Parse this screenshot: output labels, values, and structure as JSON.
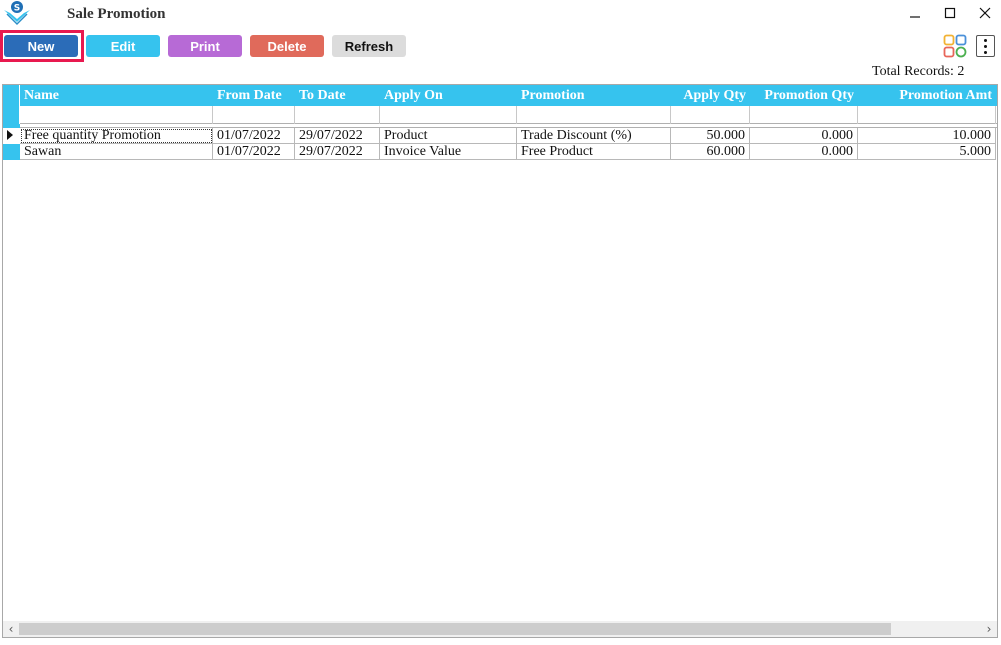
{
  "window": {
    "title": "Sale Promotion"
  },
  "toolbar": {
    "new_label": "New",
    "edit_label": "Edit",
    "print_label": "Print",
    "delete_label": "Delete",
    "refresh_label": "Refresh"
  },
  "icons": {
    "app": "app-logo-icon",
    "layout": "layout-grid-icon",
    "more": "more-vertical-icon"
  },
  "total_records": "Total Records: 2",
  "table": {
    "columns": [
      "Name",
      "From Date",
      "To Date",
      "Apply On",
      "Promotion",
      "Apply Qty",
      "Promotion Qty",
      "Promotion Amt"
    ],
    "rows": [
      [
        "Free quantity Promotion",
        "01/07/2022",
        "29/07/2022",
        "Product",
        "Trade Discount (%)",
        "50.000",
        "0.000",
        "10.000"
      ],
      [
        "Sawan",
        "01/07/2022",
        "29/07/2022",
        "Invoice Value",
        "Free Product",
        "60.000",
        "0.000",
        "5.000"
      ]
    ]
  },
  "colors": {
    "header": "#36c3ee",
    "new": "#2b6cb8",
    "edit": "#36c3ee",
    "print": "#b76ad6",
    "delete": "#e06a5b",
    "refresh": "#dcdcdc",
    "highlight": "#e8194f"
  }
}
